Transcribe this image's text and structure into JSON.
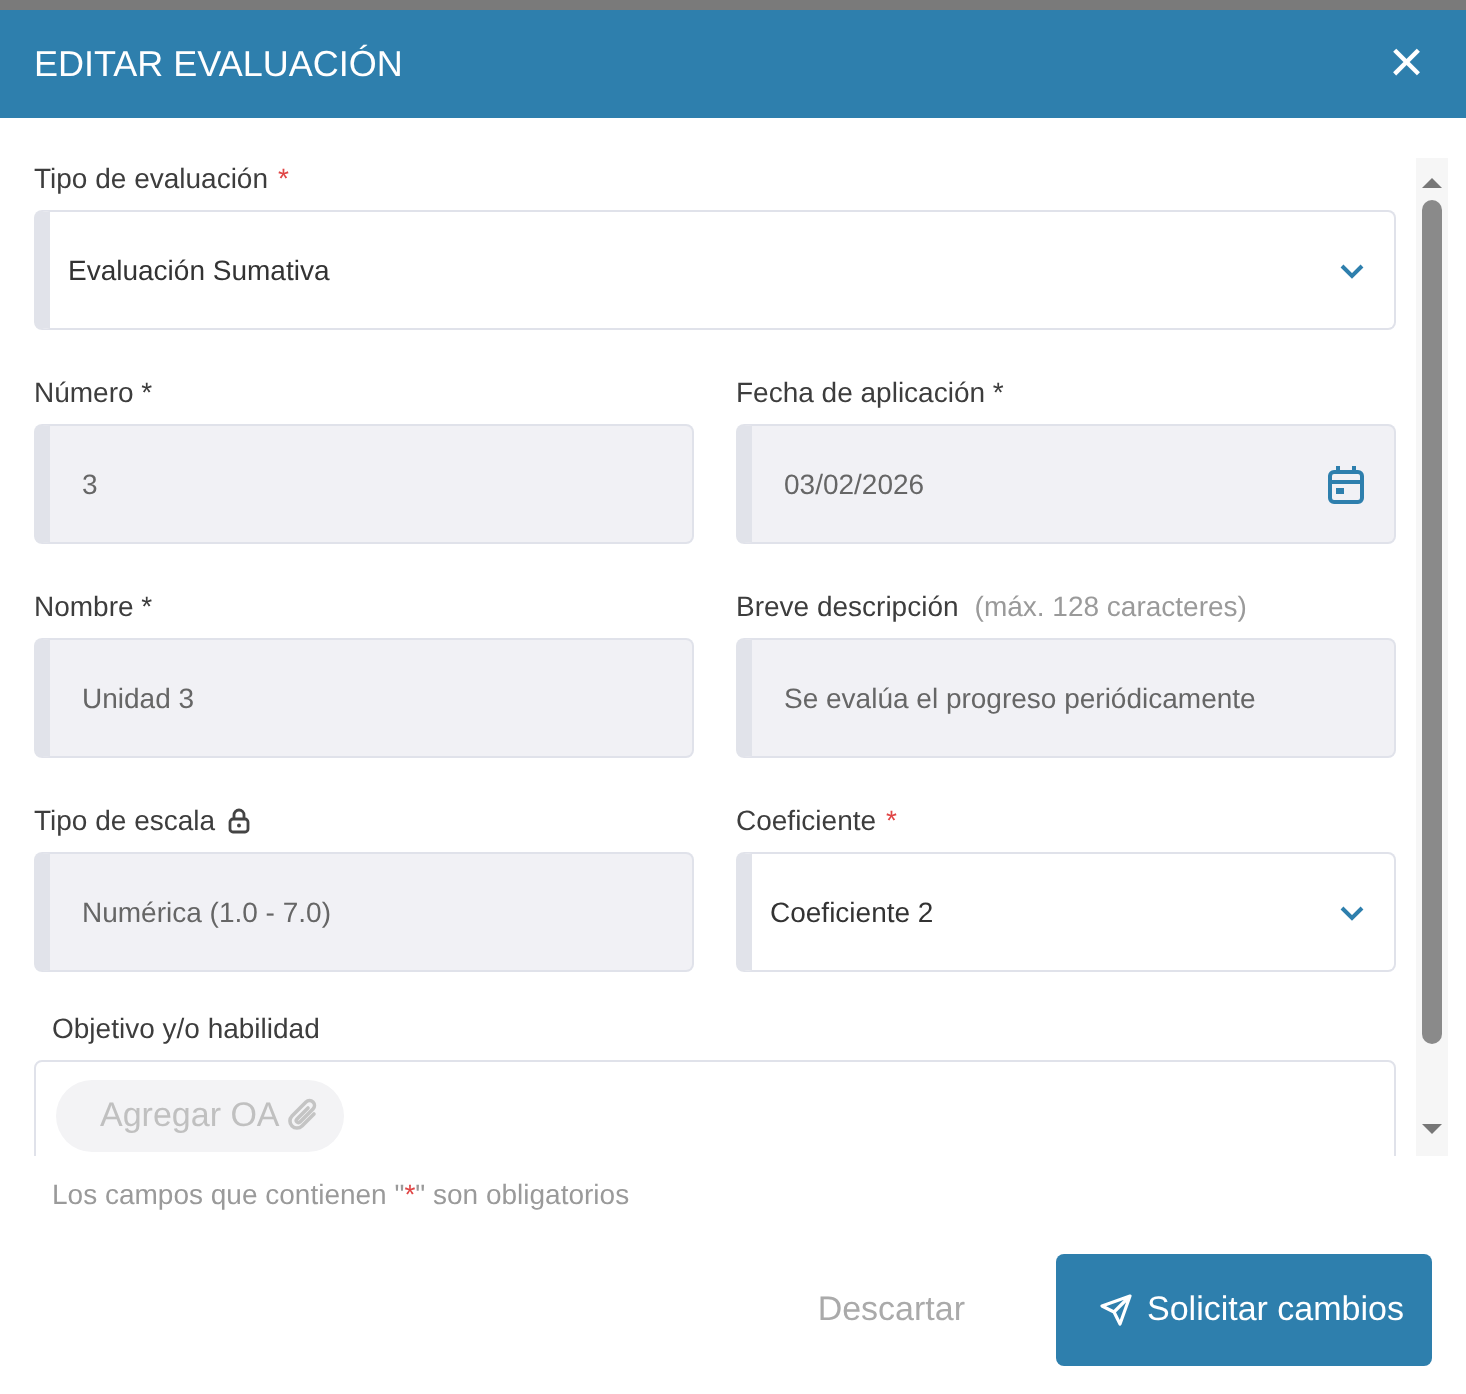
{
  "dialog": {
    "title": "EDITAR EVALUACIÓN",
    "close": "×"
  },
  "rows": [
    [
      {
        "kind": "select",
        "label": "Tipo de evaluación",
        "required_mark": "*",
        "value": "Evaluación Sumativa",
        "disabled": false
      }
    ],
    [
      {
        "kind": "input",
        "label": "Número *",
        "value": "3",
        "disabled": true
      },
      {
        "kind": "date",
        "label": "Fecha de aplicación *",
        "value": "03/02/2026",
        "disabled": true
      }
    ],
    [
      {
        "kind": "input",
        "label": "Nombre *",
        "value": "Unidad 3",
        "disabled": true
      },
      {
        "kind": "input",
        "label": "Breve descripción",
        "hint": "(máx. 128 caracteres)",
        "value": "Se evalúa el progreso periódicamente",
        "disabled": true
      }
    ],
    [
      {
        "kind": "input",
        "label": "Tipo de escala",
        "locked": true,
        "value": "Numérica (1.0 - 7.0)",
        "disabled": true
      },
      {
        "kind": "select",
        "label": "Coeficiente",
        "required_mark": "*",
        "value": "Coeficiente 2",
        "disabled": false
      }
    ]
  ],
  "objective": {
    "label": "Objetivo y/o habilidad",
    "button": "Agregar OA"
  },
  "note": {
    "before": "Los campos que contienen \"",
    "mark": "*",
    "after": "\" son obligatorios"
  },
  "buttons": [
    {
      "kind": "secondary",
      "label": "Descartar"
    },
    {
      "kind": "primary",
      "label": "Solicitar cambios"
    }
  ]
}
